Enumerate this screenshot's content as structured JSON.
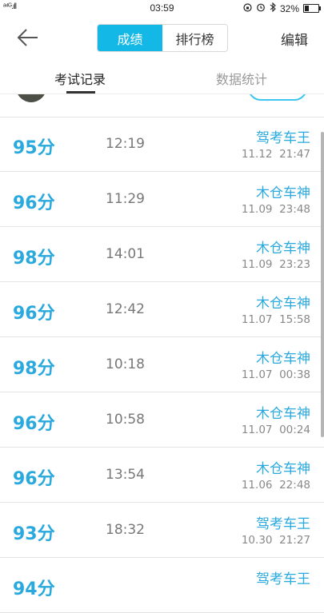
{
  "status_bar": {
    "signal": "ᵃ⁴ᴳ.ıll",
    "time": "03:59",
    "battery": "32%",
    "battery_level": 0.32,
    "icons": [
      "lock-rotation-icon",
      "alarm-icon",
      "bluetooth-icon"
    ]
  },
  "header": {
    "segments": [
      {
        "label": "成绩",
        "active": true
      },
      {
        "label": "排行榜",
        "active": false
      }
    ],
    "edit_label": "编辑",
    "accent": "#14b8e6"
  },
  "tabs": [
    {
      "label": "考试记录",
      "active": true
    },
    {
      "label": "数据统计",
      "active": false
    }
  ],
  "records": [
    {
      "score": "95分",
      "duration": "12:19",
      "name": "驾考车王",
      "date": "11.12",
      "time": "21:47"
    },
    {
      "score": "96分",
      "duration": "11:29",
      "name": "木仓车神",
      "date": "11.09",
      "time": "23:48"
    },
    {
      "score": "98分",
      "duration": "14:01",
      "name": "木仓车神",
      "date": "11.09",
      "time": "23:23"
    },
    {
      "score": "96分",
      "duration": "12:42",
      "name": "木仓车神",
      "date": "11.07",
      "time": "15:58"
    },
    {
      "score": "98分",
      "duration": "10:18",
      "name": "木仓车神",
      "date": "11.07",
      "time": "00:38"
    },
    {
      "score": "96分",
      "duration": "10:58",
      "name": "木仓车神",
      "date": "11.07",
      "time": "00:24"
    },
    {
      "score": "96分",
      "duration": "13:54",
      "name": "木仓车神",
      "date": "11.06",
      "time": "22:48"
    },
    {
      "score": "93分",
      "duration": "18:32",
      "name": "驾考车王",
      "date": "10.30",
      "time": "21:27"
    },
    {
      "score": "94分",
      "duration": "",
      "name": "驾考车王",
      "date": "",
      "time": ""
    }
  ],
  "colors": {
    "score": "#29a9dd",
    "name": "#29a9dd",
    "muted": "#888888"
  }
}
